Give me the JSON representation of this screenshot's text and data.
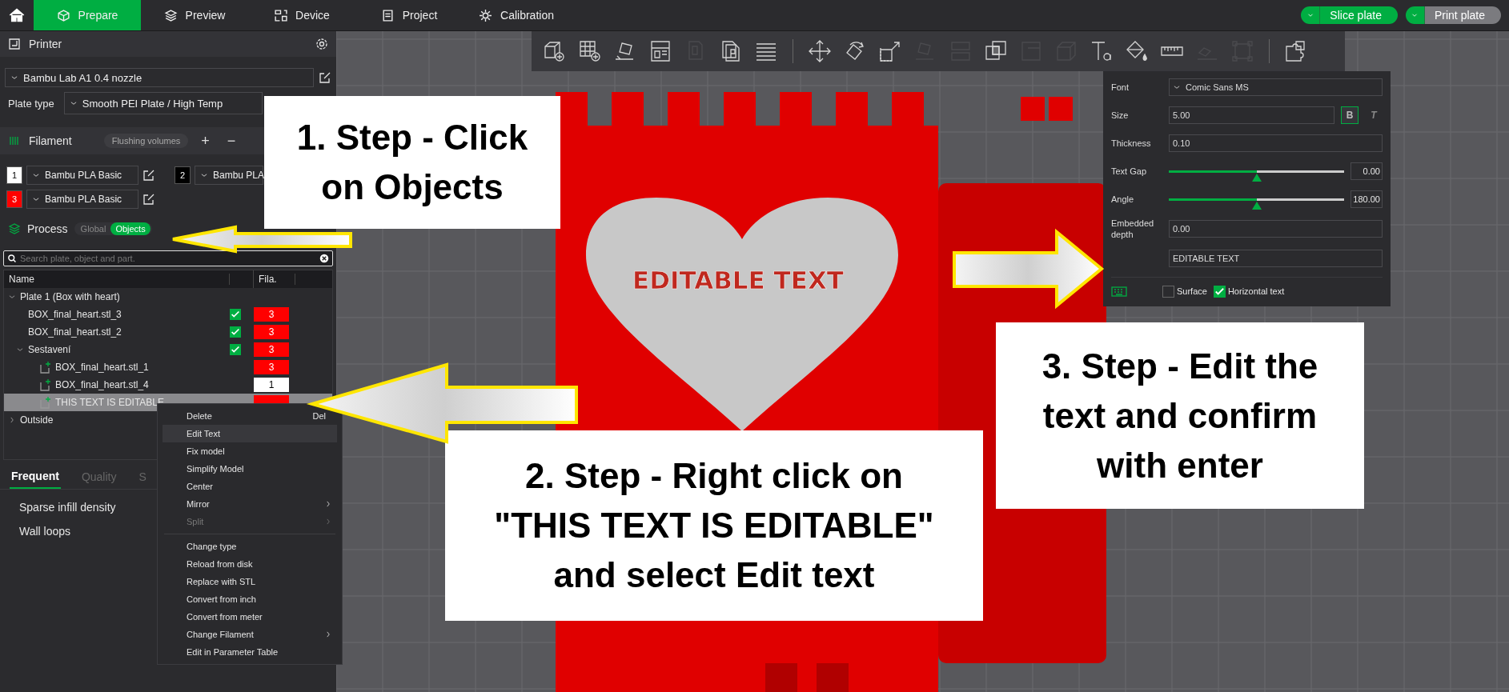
{
  "top_bar": {
    "tabs": [
      {
        "label": "Prepare",
        "selected": true
      },
      {
        "label": "Preview",
        "selected": false
      },
      {
        "label": "Device",
        "selected": false
      },
      {
        "label": "Project",
        "selected": false
      },
      {
        "label": "Calibration",
        "selected": false
      }
    ],
    "actions": [
      {
        "label": "Slice plate",
        "kind": "primary"
      },
      {
        "label": "Print plate",
        "kind": "secondary"
      }
    ]
  },
  "sidebar": {
    "printer": {
      "title": "Printer",
      "preset": "Bambu Lab A1 0.4 nozzle",
      "plate_type_label": "Plate type",
      "plate_type": "Smooth PEI Plate / High Temp"
    },
    "filament": {
      "title": "Filament",
      "flushing_button": "Flushing volumes",
      "add": "+",
      "remove": "−",
      "slots": [
        {
          "number": "1",
          "color": "#ffffff",
          "name": "Bambu PLA Basic"
        },
        {
          "number": "2",
          "color": "#000000",
          "name": "Bambu PLA"
        },
        {
          "number": "3",
          "color": "#ff0000",
          "name": "Bambu PLA Basic"
        }
      ]
    },
    "process": {
      "title": "Process",
      "modes": [
        {
          "label": "Global",
          "selected": false
        },
        {
          "label": "Objects",
          "selected": true
        }
      ]
    },
    "search": {
      "placeholder": "Search plate, object and part."
    },
    "object_list": {
      "columns": [
        "Name",
        "Fila."
      ],
      "tree": [
        {
          "kind": "container",
          "name": "Plate 1 (Box with heart)",
          "expanded": true,
          "selected": false,
          "children": [
            {
              "kind": "object",
              "name": "BOX_final_heart.stl_3",
              "checked": true,
              "selected": false,
              "fila": {
                "label": "3",
                "color": "#ff0000"
              }
            },
            {
              "kind": "object",
              "name": "BOX_final_heart.stl_2",
              "checked": true,
              "selected": false,
              "fila": {
                "label": "3",
                "color": "#ff0000"
              }
            },
            {
              "kind": "container",
              "name": "Sestavení",
              "expanded": true,
              "checked": true,
              "selected": false,
              "fila": {
                "label": "3",
                "color": "#ff0000"
              },
              "children": [
                {
                  "kind": "part",
                  "name": "BOX_final_heart.stl_1",
                  "selected": false,
                  "fila": {
                    "label": "3",
                    "color": "#ff0000"
                  }
                },
                {
                  "kind": "part",
                  "name": "BOX_final_heart.stl_4",
                  "selected": false,
                  "fila": {
                    "label": "1",
                    "color": "#ffffff"
                  }
                },
                {
                  "kind": "part",
                  "name": "THIS TEXT IS EDITABLE",
                  "selected": true,
                  "fila": {
                    "color": "#ff0000"
                  }
                }
              ]
            }
          ]
        },
        {
          "kind": "container",
          "name": "Outside",
          "expanded": false,
          "selected": false
        }
      ]
    },
    "settings_tabs": [
      {
        "label": "Frequent",
        "selected": true
      },
      {
        "label": "Quality",
        "selected": false
      },
      {
        "label": "S",
        "selected": false
      }
    ],
    "settings": [
      "Sparse infill density",
      "Wall loops"
    ]
  },
  "context_menu": {
    "items": [
      {
        "kind": "item",
        "label": "Delete",
        "shortcut": "Del",
        "highlighted": false,
        "disabled": false,
        "submenu": false
      },
      {
        "kind": "item",
        "label": "Edit Text",
        "highlighted": true,
        "disabled": false,
        "submenu": false
      },
      {
        "kind": "item",
        "label": "Fix model",
        "highlighted": false,
        "disabled": false,
        "submenu": false
      },
      {
        "kind": "item",
        "label": "Simplify Model",
        "highlighted": false,
        "disabled": false,
        "submenu": false
      },
      {
        "kind": "item",
        "label": "Center",
        "highlighted": false,
        "disabled": false,
        "submenu": false
      },
      {
        "kind": "item",
        "label": "Mirror",
        "highlighted": false,
        "disabled": false,
        "submenu": true
      },
      {
        "kind": "item",
        "label": "Split",
        "highlighted": false,
        "disabled": true,
        "submenu": true
      },
      {
        "kind": "separator"
      },
      {
        "kind": "item",
        "label": "Change type",
        "highlighted": false,
        "disabled": false,
        "submenu": false
      },
      {
        "kind": "item",
        "label": "Reload from disk",
        "highlighted": false,
        "disabled": false,
        "submenu": false
      },
      {
        "kind": "item",
        "label": "Replace with STL",
        "highlighted": false,
        "disabled": false,
        "submenu": false
      },
      {
        "kind": "item",
        "label": "Convert from inch",
        "highlighted": false,
        "disabled": false,
        "submenu": false
      },
      {
        "kind": "item",
        "label": "Convert from meter",
        "highlighted": false,
        "disabled": false,
        "submenu": false
      },
      {
        "kind": "item",
        "label": "Change Filament",
        "highlighted": false,
        "disabled": false,
        "submenu": true
      },
      {
        "kind": "item",
        "label": "Edit in Parameter Table",
        "highlighted": false,
        "disabled": false,
        "submenu": false
      }
    ]
  },
  "toolbar": [
    {
      "disabled": false
    },
    {
      "disabled": false
    },
    {
      "disabled": false
    },
    {
      "disabled": false
    },
    {
      "disabled": true
    },
    {
      "disabled": false
    },
    {
      "disabled": false
    },
    {
      "disabled": false
    },
    {
      "disabled": false
    },
    {
      "disabled": false
    },
    {
      "disabled": true
    },
    {
      "disabled": true
    },
    {
      "disabled": false
    },
    {
      "disabled": true
    },
    {
      "disabled": true
    },
    {
      "disabled": false
    },
    {
      "disabled": false
    },
    {
      "disabled": false
    },
    {
      "disabled": true
    },
    {
      "disabled": true
    },
    {
      "disabled": false
    }
  ],
  "viewport": {
    "model_text": "EDITABLE TEXT"
  },
  "text_tool": {
    "rows": [
      {
        "kind": "select",
        "label": "Font",
        "value": "Comic Sans MS"
      },
      {
        "kind": "size",
        "label": "Size",
        "value": "5.00",
        "bold": true,
        "italic": false,
        "bold_glyph": "B",
        "italic_glyph": "T"
      },
      {
        "kind": "input",
        "label": "Thickness",
        "value": "0.10"
      },
      {
        "kind": "slider",
        "label": "Text Gap",
        "level": 0.5,
        "value": "0.00"
      },
      {
        "kind": "slider",
        "label": "Angle",
        "level": 0.5,
        "value": "180.00"
      },
      {
        "kind": "input",
        "label": "Embedded depth",
        "value": "0.00"
      },
      {
        "kind": "input",
        "value": "EDITABLE TEXT"
      }
    ],
    "options": [
      {
        "label": "Surface",
        "checked": false
      },
      {
        "label": "Horizontal text",
        "checked": true
      }
    ]
  },
  "callouts": [
    {
      "lines": [
        "1. Step - Click",
        "on Objects"
      ]
    },
    {
      "lines": [
        "2. Step - Right click on",
        "\"THIS TEXT IS EDITABLE\"",
        "and select Edit text"
      ]
    },
    {
      "lines": [
        "3. Step - Edit the",
        "text and confirm",
        "with enter"
      ]
    }
  ]
}
